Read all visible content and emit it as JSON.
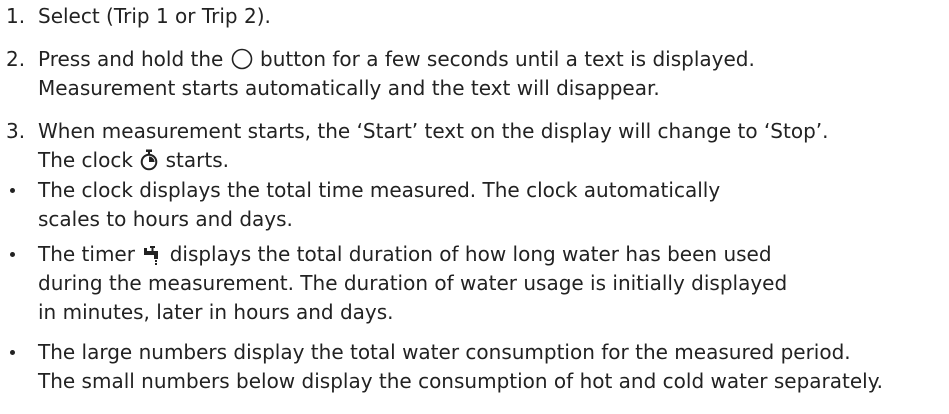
{
  "steps": [
    {
      "marker": "1.",
      "lines": [
        "Select (Trip 1 or Trip 2)."
      ]
    },
    {
      "marker": "2.",
      "lines_a": "Press and hold the",
      "lines_b": "button for a few seconds until a text is displayed.",
      "line2": "Measurement starts automatically and the text will disappear."
    },
    {
      "marker": "3.",
      "line1": "When measurement starts, the ‘Start’ text on the display will change to ‘Stop’.",
      "line2_a": "The clock",
      "line2_b": "starts."
    }
  ],
  "bullets": [
    {
      "line1": "The clock displays the total time measured. The clock automatically",
      "line2": "scales to hours and days."
    },
    {
      "line1_a": "The timer",
      "line1_b": "displays the total duration of how long water has been used",
      "line2": "during the measurement. The duration of water usage is initially displayed",
      "line3": "in minutes, later in hours and days."
    },
    {
      "line1": "The large numbers display the total water consumption for the measured period.",
      "line2": "The small numbers below display the consumption of hot and cold water separately."
    }
  ],
  "icons": {
    "button": "circle-button-icon",
    "clock": "stopwatch-icon",
    "timer": "tap-timer-icon"
  },
  "text_color": "#222222"
}
